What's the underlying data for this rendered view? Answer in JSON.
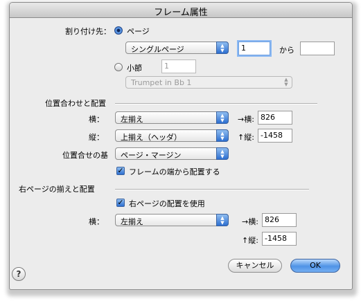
{
  "window": {
    "title": "フレーム属性"
  },
  "attach": {
    "label": "割り付け先：",
    "page_radio_label": "ページ",
    "page_popup": "シングルページ",
    "from_value": "1",
    "from_label": "から",
    "to_value": "",
    "measure_radio_label": "小節",
    "measure_value": "1",
    "instrument_popup": "Trumpet in Bb 1"
  },
  "alignment": {
    "section_label": "位置合わせと配置",
    "horizontal_label": "横：",
    "horizontal_popup": "左揃え",
    "h_offset_label": "→横:",
    "h_offset_value": "826",
    "vertical_label": "縦：",
    "vertical_popup": "上揃え（ヘッダ）",
    "v_offset_label": "↑縦:",
    "v_offset_value": "-1458",
    "basis_label": "位置合せの基",
    "basis_popup": "ページ・マージン",
    "edge_checkbox_label": "フレームの端から配置する",
    "edge_checked": true
  },
  "right_page": {
    "section_label": "右ページの揃えと配置",
    "use_checkbox_label": "右ページの配置を使用",
    "use_checked": true,
    "horizontal_label": "横：",
    "horizontal_popup": "左揃え",
    "h_offset_label": "→横:",
    "h_offset_value": "826",
    "v_offset_label": "↑縦:",
    "v_offset_value": "-1458"
  },
  "buttons": {
    "cancel": "キャンセル",
    "ok": "OK",
    "help": "?"
  }
}
